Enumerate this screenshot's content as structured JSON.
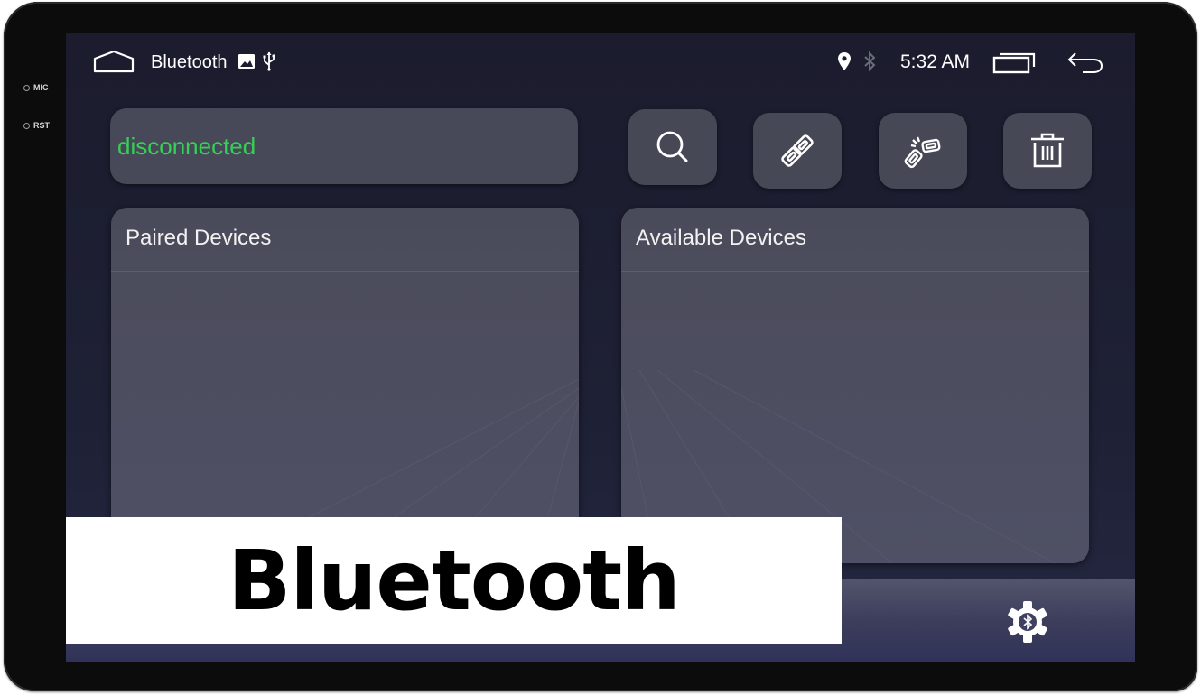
{
  "device": {
    "hw_labels": [
      "MIC",
      "RST"
    ]
  },
  "statusbar": {
    "home_icon": "home-icon",
    "app_title": "Bluetooth",
    "notification_icons": [
      "image-icon",
      "usb-icon"
    ],
    "system_icons": [
      "location-icon",
      "bluetooth-icon"
    ],
    "time": "5:32 AM",
    "recents_icon": "recents-icon",
    "back_icon": "back-icon"
  },
  "connection": {
    "status": "disconnected",
    "status_color": "#35d055"
  },
  "actions": [
    {
      "id": "search",
      "icon": "search-icon",
      "label": "Search"
    },
    {
      "id": "connect",
      "icon": "link-icon",
      "label": "Connect"
    },
    {
      "id": "disconnect",
      "icon": "broken-link-icon",
      "label": "Disconnect"
    },
    {
      "id": "delete",
      "icon": "trash-icon",
      "label": "Delete"
    }
  ],
  "panels": {
    "paired": {
      "title": "Paired Devices",
      "items": []
    },
    "available": {
      "title": "Available Devices",
      "items": []
    }
  },
  "bottombar": {
    "settings_icon": "bluetooth-settings-icon"
  },
  "caption": {
    "text": "Bluetooth"
  },
  "colors": {
    "screen_bg": "#1b1c2d",
    "card_bg": "#484958",
    "accent_green": "#35d055",
    "text": "#ffffff"
  }
}
